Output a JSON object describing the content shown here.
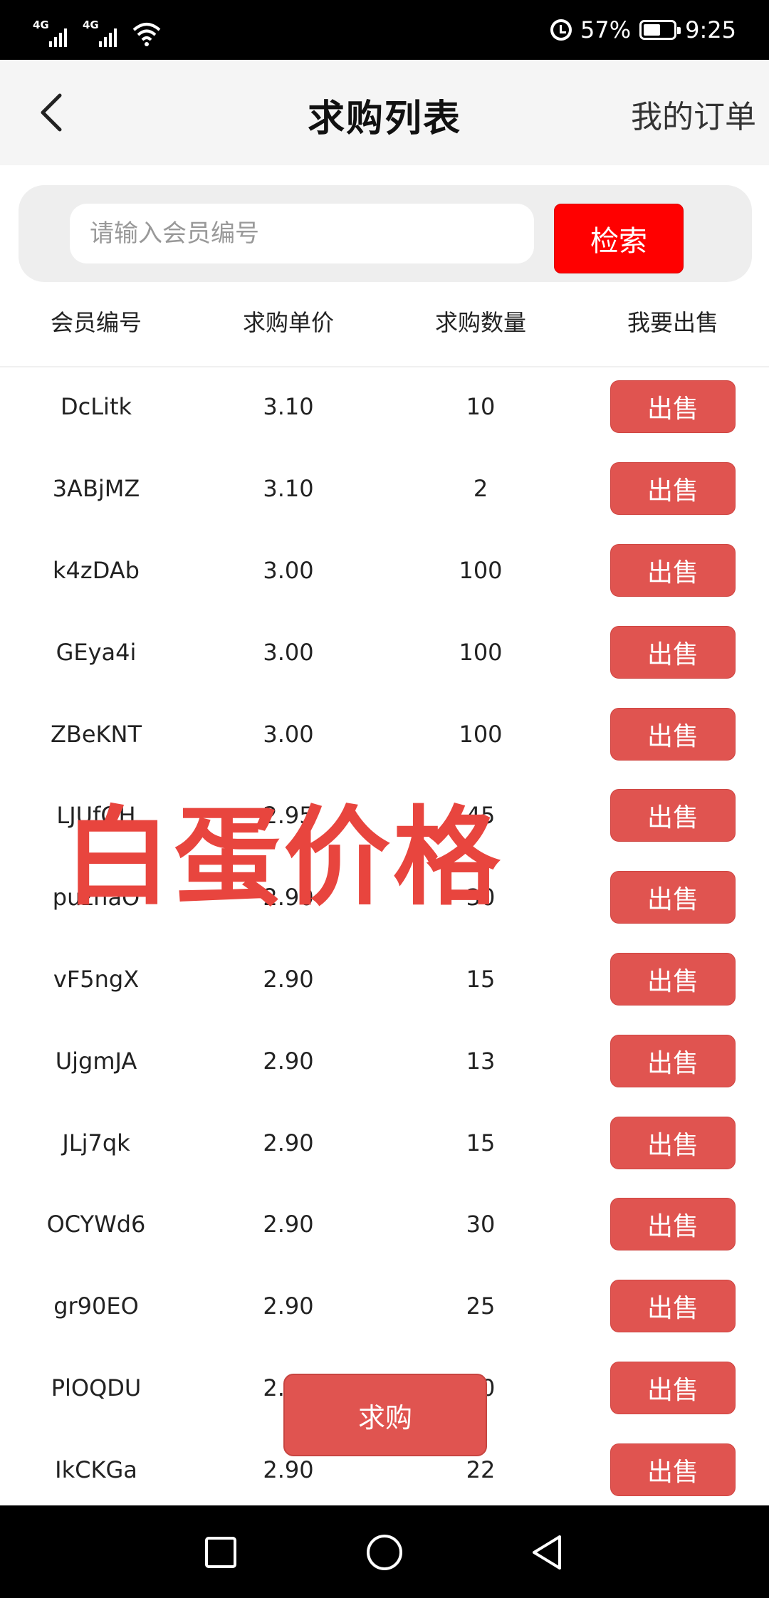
{
  "status_bar": {
    "signal1_label": "4G",
    "signal2_label": "4G",
    "battery_percent": "57%",
    "battery_level": 0.57,
    "time": "9:25"
  },
  "header": {
    "title": "求购列表",
    "my_orders_label": "我的订单"
  },
  "search": {
    "placeholder": "请输入会员编号",
    "value": "",
    "button_label": "检索"
  },
  "table": {
    "columns": [
      "会员编号",
      "求购单价",
      "求购数量",
      "我要出售"
    ],
    "sell_label": "出售",
    "rows": [
      {
        "member": "DcLitk",
        "price": "3.10",
        "qty": "10"
      },
      {
        "member": "3ABjMZ",
        "price": "3.10",
        "qty": "2"
      },
      {
        "member": "k4zDAb",
        "price": "3.00",
        "qty": "100"
      },
      {
        "member": "GEya4i",
        "price": "3.00",
        "qty": "100"
      },
      {
        "member": "ZBeKNT",
        "price": "3.00",
        "qty": "100"
      },
      {
        "member": "LJUfOH",
        "price": "2.95",
        "qty": "45"
      },
      {
        "member": "puzhaO",
        "price": "2.90",
        "qty": "30"
      },
      {
        "member": "vF5ngX",
        "price": "2.90",
        "qty": "15"
      },
      {
        "member": "UjgmJA",
        "price": "2.90",
        "qty": "13"
      },
      {
        "member": "JLj7qk",
        "price": "2.90",
        "qty": "15"
      },
      {
        "member": "OCYWd6",
        "price": "2.90",
        "qty": "30"
      },
      {
        "member": "gr90EO",
        "price": "2.90",
        "qty": "25"
      },
      {
        "member": "PlOQDU",
        "price": "2.90",
        "qty": "10"
      },
      {
        "member": "IkCKGa",
        "price": "2.90",
        "qty": "22"
      }
    ]
  },
  "watermark_text": "白蛋价格",
  "buy_button_label": "求购",
  "colors": {
    "accent_red": "#e05450",
    "search_red": "#ff0000",
    "status_bar_bg": "#000000"
  },
  "icons": {
    "back": "chevron-left-icon",
    "nav_recent": "square-icon",
    "nav_home": "circle-icon",
    "nav_back": "triangle-icon"
  }
}
